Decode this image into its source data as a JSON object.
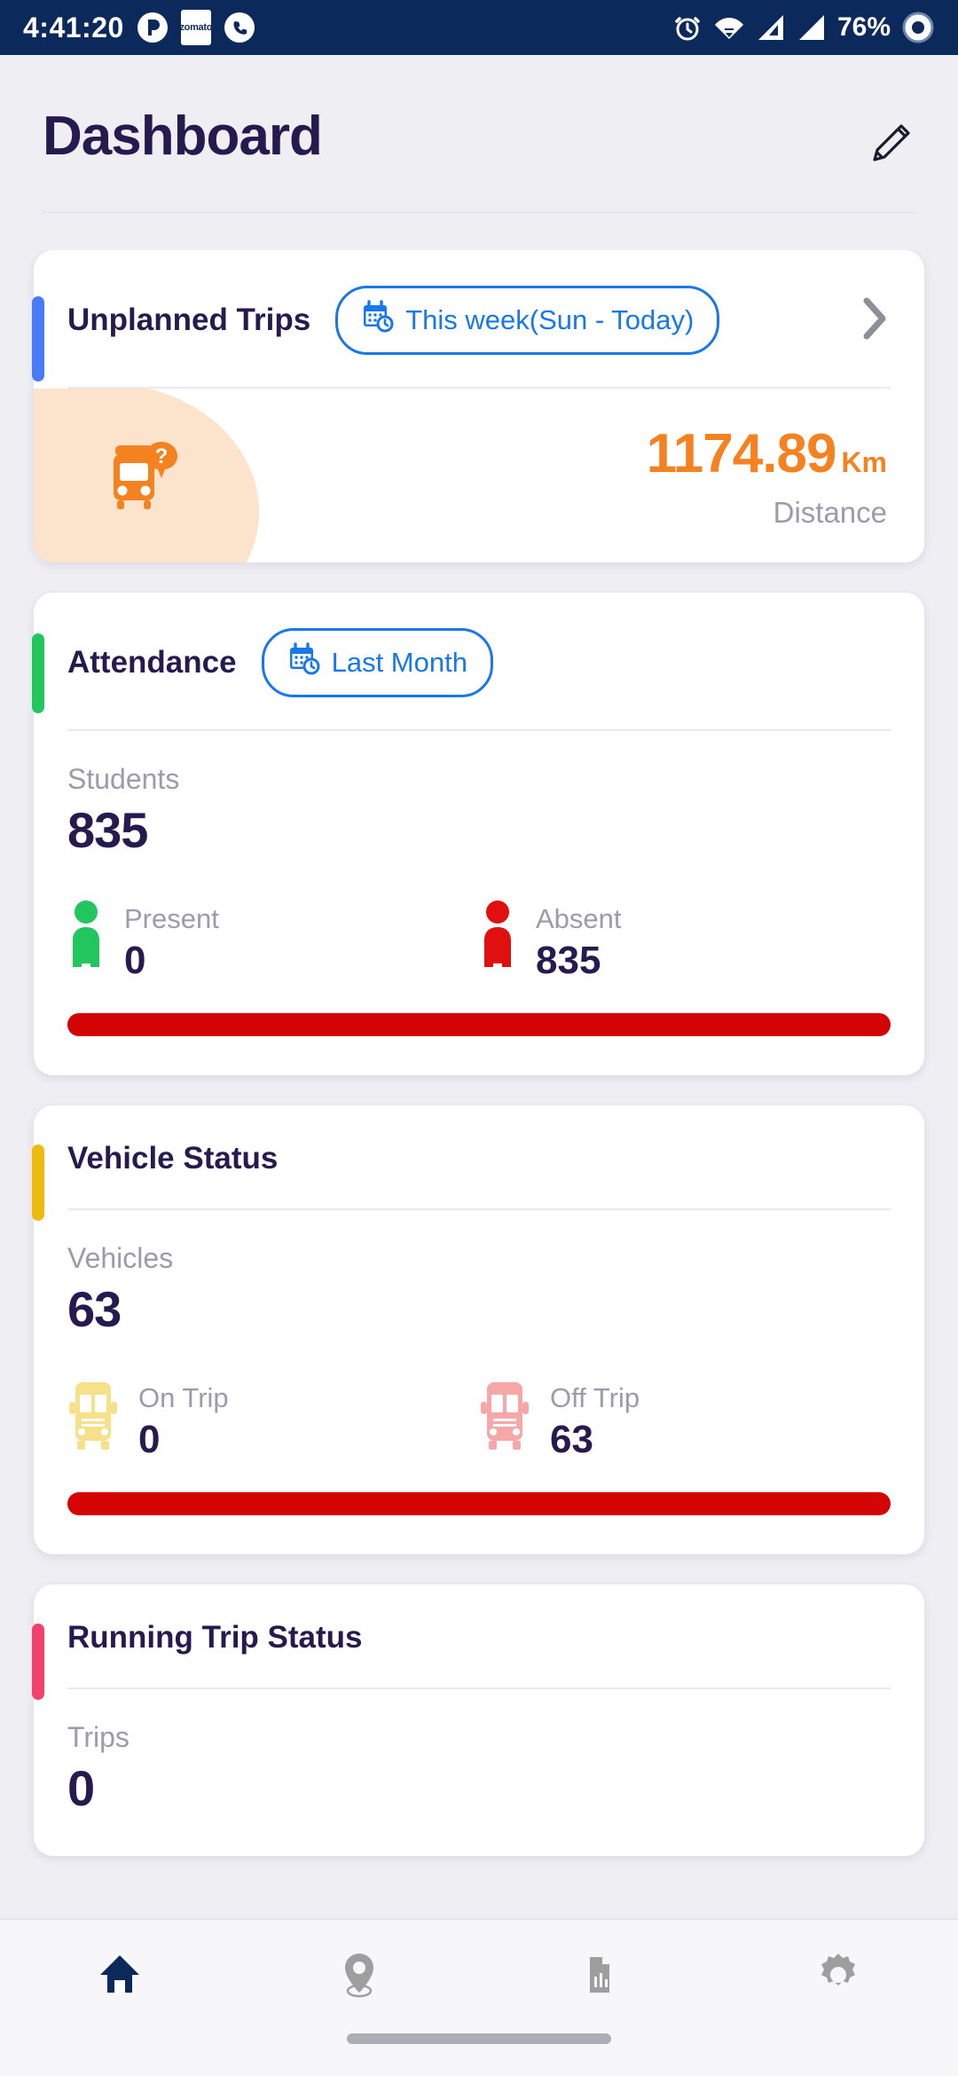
{
  "status_bar": {
    "time": "4:41:20",
    "battery_percent": "76%",
    "left_icons": [
      "app-notification-icon",
      "zomato-icon",
      "phone-icon"
    ],
    "zomato_label": "zomato",
    "right_icons": [
      "alarm-icon",
      "wifi-icon",
      "signal-icon",
      "signal-2-icon",
      "vpn-icon"
    ],
    "background_color": "#0B2A5B"
  },
  "header": {
    "title": "Dashboard",
    "edit_icon": "pencil-icon"
  },
  "cards": [
    {
      "id": "unplanned-trips",
      "title": "Unplanned Trips",
      "accent_color": "#4A7BF7",
      "chip": {
        "label": "This week(Sun - Today)",
        "icon": "calendar-clock-icon"
      },
      "has_chevron": true,
      "metric": {
        "icon": "bus-question-icon",
        "value": "1174.89",
        "unit": "Km",
        "label": "Distance",
        "color": "#F58220"
      }
    },
    {
      "id": "attendance",
      "title": "Attendance",
      "accent_color": "#22C55E",
      "chip": {
        "label": "Last Month",
        "icon": "calendar-clock-icon"
      },
      "has_chevron": false,
      "stat": {
        "caption": "Students",
        "total": "835",
        "legends": [
          {
            "icon": "person-icon",
            "label": "Present",
            "value": "0",
            "color": "#22C55E"
          },
          {
            "icon": "person-icon",
            "label": "Absent",
            "value": "835",
            "color": "#E01010"
          }
        ],
        "progress": [
          {
            "color": "#22C55E",
            "percent": 0
          },
          {
            "color": "#D40404",
            "percent": 100
          }
        ]
      }
    },
    {
      "id": "vehicle-status",
      "title": "Vehicle Status",
      "accent_color": "#EDBB10",
      "chip": null,
      "has_chevron": false,
      "stat": {
        "caption": "Vehicles",
        "total": "63",
        "legends": [
          {
            "icon": "bus-front-icon",
            "label": "On Trip",
            "value": "0",
            "color": "#F7E08A"
          },
          {
            "icon": "bus-front-icon",
            "label": "Off Trip",
            "value": "63",
            "color": "#F6A7A7"
          }
        ],
        "progress": [
          {
            "color": "#F7E08A",
            "percent": 0
          },
          {
            "color": "#D40404",
            "percent": 100
          }
        ]
      }
    },
    {
      "id": "running-trip-status",
      "title": "Running Trip Status",
      "accent_color": "#F0426A",
      "chip": null,
      "has_chevron": false,
      "stat": {
        "caption": "Trips",
        "total": "0",
        "legends": [],
        "progress": []
      }
    }
  ],
  "bottom_nav": {
    "items": [
      {
        "icon": "home-icon",
        "active": true,
        "color": "#0B2A5B"
      },
      {
        "icon": "location-pin-icon",
        "active": false,
        "color": "#9E9E9E"
      },
      {
        "icon": "report-chart-icon",
        "active": false,
        "color": "#9E9E9E"
      },
      {
        "icon": "gear-icon",
        "active": false,
        "color": "#9E9E9E"
      }
    ]
  }
}
